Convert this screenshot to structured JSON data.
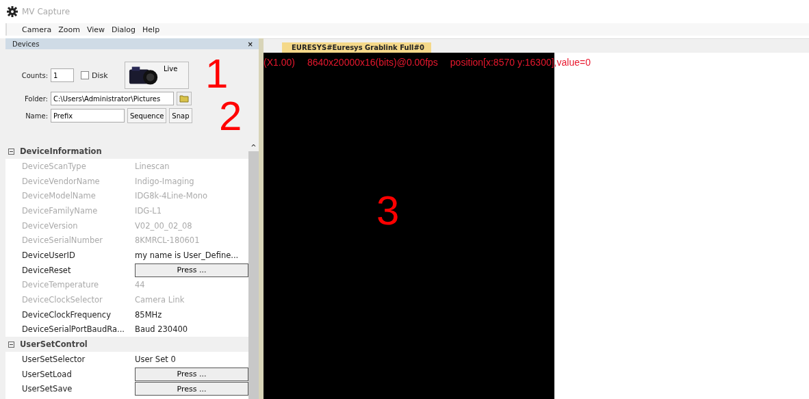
{
  "window": {
    "title": "MV Capture"
  },
  "menu": [
    "Camera",
    "Zoom",
    "View",
    "Dialog",
    "Help"
  ],
  "devices_panel": {
    "title": "Devices",
    "close": "×",
    "counts": {
      "label": "Counts:",
      "value": "1"
    },
    "to_disk": {
      "label": "Disk",
      "checked": false
    },
    "live_button": "Live",
    "folder": {
      "label": "Folder:",
      "value": "C:\\Users\\Administrator\\Pictures"
    },
    "name": {
      "label": "Name:",
      "value": "Prefix"
    },
    "sequence_button": "Sequence",
    "snap_button": "Snap",
    "groups": [
      {
        "title": "DeviceInformation",
        "expanded": true,
        "rows": [
          {
            "name": "DeviceScanType",
            "value": "Linescan",
            "kind": "text",
            "disabled": true
          },
          {
            "name": "DeviceVendorName",
            "value": "Indigo-Imaging",
            "kind": "text",
            "disabled": true
          },
          {
            "name": "DeviceModelName",
            "value": "IDG8k-4Line-Mono",
            "kind": "text",
            "disabled": true
          },
          {
            "name": "DeviceFamilyName",
            "value": "IDG-L1",
            "kind": "text",
            "disabled": true
          },
          {
            "name": "DeviceVersion",
            "value": "V02_00_02_08",
            "kind": "text",
            "disabled": true
          },
          {
            "name": "DeviceSerialNumber",
            "value": "8KMRCL-180601",
            "kind": "text",
            "disabled": true
          },
          {
            "name": "DeviceUserID",
            "value": "my name is User_Define...",
            "kind": "text",
            "disabled": false
          },
          {
            "name": "DeviceReset",
            "value": "Press ...",
            "kind": "button",
            "disabled": false
          },
          {
            "name": "DeviceTemperature",
            "value": "44",
            "kind": "text",
            "disabled": true
          },
          {
            "name": "DeviceClockSelector",
            "value": "Camera Link",
            "kind": "text",
            "disabled": true
          },
          {
            "name": "DeviceClockFrequency",
            "value": "85MHz",
            "kind": "text",
            "disabled": false
          },
          {
            "name": "DeviceSerialPortBaudRa...",
            "value": "Baud 230400",
            "kind": "text",
            "disabled": false
          }
        ]
      },
      {
        "title": "UserSetControl",
        "expanded": true,
        "rows": [
          {
            "name": "UserSetSelector",
            "value": "User Set 0",
            "kind": "text",
            "disabled": false
          },
          {
            "name": "UserSetLoad",
            "value": "Press ...",
            "kind": "button",
            "disabled": false
          },
          {
            "name": "UserSetSave",
            "value": "Press ...",
            "kind": "button",
            "disabled": false
          }
        ]
      }
    ],
    "scroll_up": "^"
  },
  "viewer": {
    "tabs": [
      {
        "label": "EURESYS#Euresys Grablink Full#0",
        "selected": true
      }
    ],
    "overlay": [
      "(X1.00)",
      "8640x20000x16(bits)@0.00fps",
      "position[x:8570 y:16300],value=0"
    ]
  },
  "annotations": [
    "1",
    "2",
    "3"
  ]
}
